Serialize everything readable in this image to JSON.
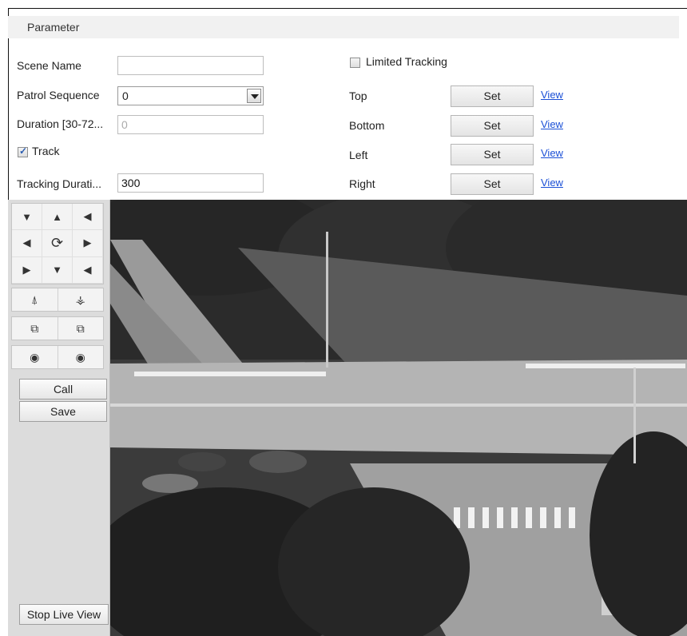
{
  "parameter": {
    "title": "Parameter"
  },
  "left_form": {
    "scene_name_label": "Scene Name",
    "scene_name_value": "",
    "patrol_sequence_label": "Patrol Sequence",
    "patrol_sequence_value": "0",
    "duration_label": "Duration [30-72...",
    "duration_value": "0",
    "track_label": "Track",
    "track_checked": true,
    "tracking_duration_label": "Tracking Durati...",
    "tracking_duration_value": "300"
  },
  "right_form": {
    "limited_tracking_label": "Limited Tracking",
    "limited_tracking_checked": false,
    "rows": [
      {
        "label": "Top",
        "set": "Set",
        "view": "View"
      },
      {
        "label": "Bottom",
        "set": "Set",
        "view": "View"
      },
      {
        "label": "Left",
        "set": "Set",
        "view": "View"
      },
      {
        "label": "Right",
        "set": "Set",
        "view": "View"
      }
    ]
  },
  "ptz": {
    "call_label": "Call",
    "save_label": "Save",
    "stop_live_view_label": "Stop Live View",
    "icons": {
      "dpad": [
        "up-left-arrow-icon",
        "up-arrow-icon",
        "up-right-arrow-icon",
        "left-arrow-icon",
        "auto-pan-icon",
        "right-arrow-icon",
        "down-left-arrow-icon",
        "down-arrow-icon",
        "down-right-arrow-icon"
      ],
      "zoom": [
        "zoom-in-icon",
        "zoom-out-icon"
      ],
      "focus": [
        "focus-near-icon",
        "focus-far-icon"
      ],
      "iris": [
        "iris-open-icon",
        "iris-close-icon"
      ]
    }
  },
  "video": {
    "description_free": true
  }
}
